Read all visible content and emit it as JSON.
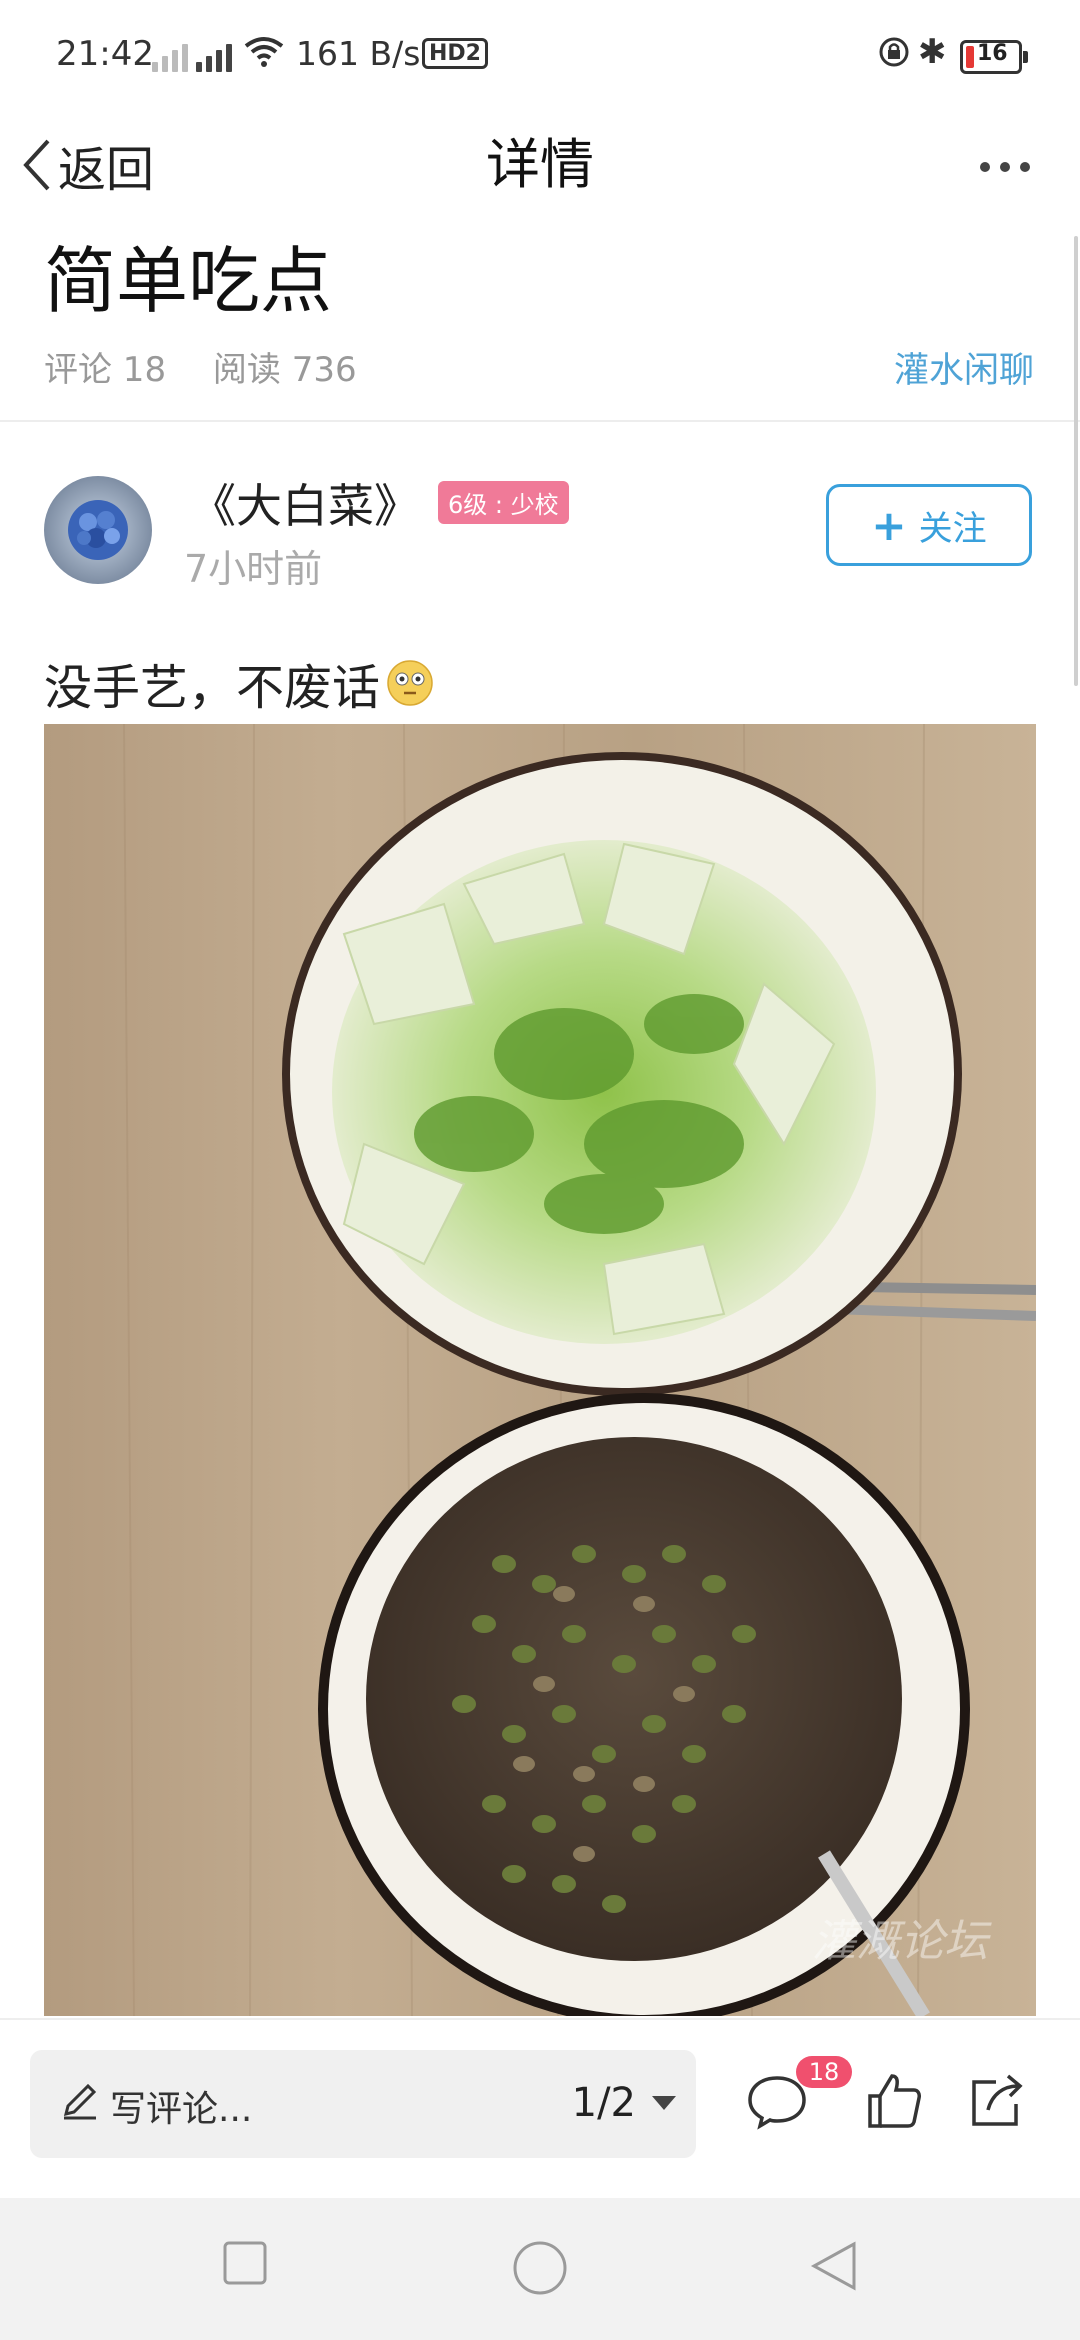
{
  "status_bar": {
    "time": "21:42",
    "network_speed": "161 B/s",
    "hd_label": "HD2",
    "battery": "16",
    "battery_color": "#e53935"
  },
  "header": {
    "back_label": "返回",
    "title": "详情",
    "more_icon": "more-dots-icon"
  },
  "post": {
    "title": "简单吃点",
    "comments": "评论 18",
    "reads": "阅读 736",
    "forum": "灌水闲聊",
    "author": "《大白菜》",
    "level": "6级 : 少校",
    "time": "7小时前",
    "follow_label": "关注",
    "content": "没手艺，不废话",
    "emoji": "flushed-face-emoji",
    "watermark": "灌溉论坛"
  },
  "bottom": {
    "comment_placeholder": "写评论...",
    "page": "1/2",
    "comment_count": "18"
  },
  "colors": {
    "accent": "#39a0dc",
    "level_badge": "#f07a98",
    "count_badge": "#f0506e"
  }
}
